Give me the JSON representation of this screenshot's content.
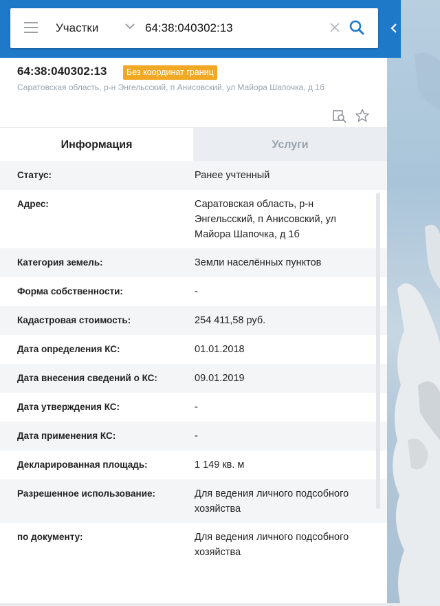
{
  "search": {
    "category": "Участки",
    "query": "64:38:040302:13"
  },
  "object": {
    "number": "64:38:040302:13",
    "badge": "Без координат границ",
    "address": "Саратовская область, р-н Энгельсский, п Анисовский, ул Майора Шапочка, д 1б"
  },
  "tabs": [
    {
      "label": "Информация",
      "active": true
    },
    {
      "label": "Услуги",
      "active": false
    }
  ],
  "info_rows": [
    {
      "label": "Статус:",
      "value": "Ранее учтенный"
    },
    {
      "label": "Адрес:",
      "value": "Саратовская область, р-н Энгельсский, п Анисовский, ул Майора Шапочка, д 1б"
    },
    {
      "label": "Категория земель:",
      "value": "Земли населённых пунктов"
    },
    {
      "label": "Форма собственности:",
      "value": "-"
    },
    {
      "label": "Кадастровая стоимость:",
      "value": "254 411,58 руб."
    },
    {
      "label": "Дата определения КС:",
      "value": "01.01.2018"
    },
    {
      "label": "Дата внесения сведений о КС:",
      "value": "09.01.2019"
    },
    {
      "label": "Дата утверждения КС:",
      "value": "-"
    },
    {
      "label": "Дата применения КС:",
      "value": "-"
    },
    {
      "label": "Декларированная площадь:",
      "value": "1 149 кв. м"
    },
    {
      "label": "Разрешенное использование:",
      "value": "Для ведения личного подсобного хозяйства"
    },
    {
      "label": "по документу:",
      "value": "Для ведения личного подсобного хозяйства"
    }
  ],
  "colors": {
    "header_blue": "#1f79c9",
    "badge_orange": "#f1a925",
    "search_icon_blue": "#1f79c9"
  },
  "icons": [
    "menu-icon",
    "chevron-down-icon",
    "clear-icon",
    "search-icon",
    "collapse-left-icon",
    "zoom-to-object-icon",
    "star-icon"
  ]
}
